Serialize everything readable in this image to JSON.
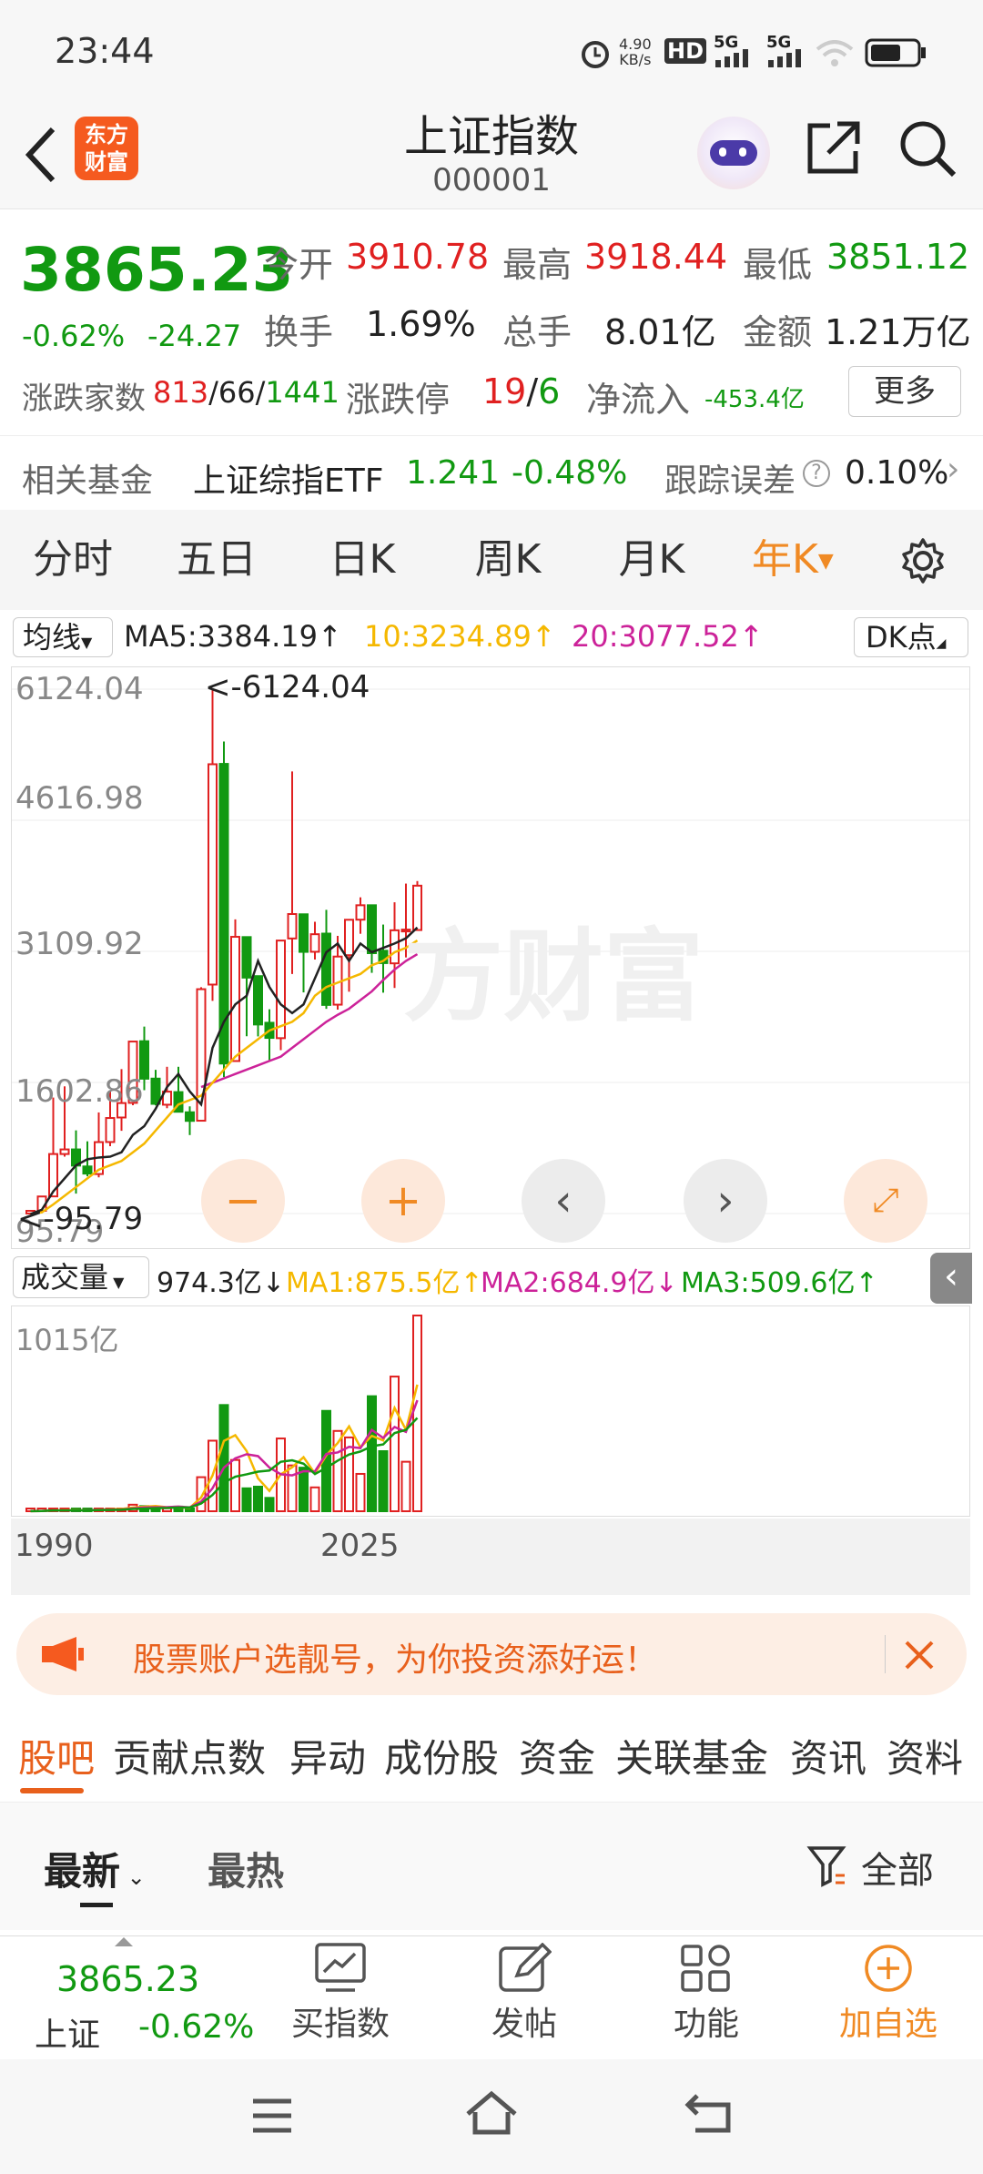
{
  "status_bar": {
    "time": "23:44",
    "net_speed_top": "4.90",
    "net_speed_bottom": "KB/s",
    "hd": "HD",
    "sig1": "5G",
    "sig2": "5G"
  },
  "header": {
    "title": "上证指数",
    "code": "000001",
    "logo_line1": "东方",
    "logo_line2": "财富"
  },
  "quote": {
    "price": "3865.23",
    "change_pct": "-0.62%",
    "change_abs": "-24.27",
    "open_label": "今开",
    "open": "3910.78",
    "high_label": "最高",
    "high": "3918.44",
    "low_label": "最低",
    "low": "3851.12",
    "turnover_label": "换手",
    "turnover": "1.69%",
    "volume_label": "总手",
    "volume": "8.01亿",
    "amount_label": "金额",
    "amount": "1.21万亿",
    "breadth_label": "涨跌家数",
    "breadth_up": "813",
    "breadth_flat": "66",
    "breadth_down": "1441",
    "limit_label": "涨跌停",
    "limit_up": "19",
    "limit_down": "6",
    "netflow_label": "净流入",
    "netflow": "-453.4亿",
    "more_button": "更多"
  },
  "fund": {
    "label": "相关基金",
    "name": "上证综指ETF",
    "price": "1.241",
    "change": "-0.48%",
    "error_label": "跟踪误差",
    "error_value": "0.10%"
  },
  "chart_tabs": [
    "分时",
    "五日",
    "日K",
    "周K",
    "月K",
    "年K"
  ],
  "ma_bar": {
    "selector": "均线",
    "ma5": "MA5:3384.19↑",
    "ma10": "10:3234.89↑",
    "ma20": "20:3077.52↑",
    "dk": "DK点"
  },
  "colors": {
    "up": "#e02020",
    "down": "#119911",
    "accent": "#f08a24",
    "ma5": "#222222",
    "ma10": "#f5b800",
    "ma20": "#cc2299"
  },
  "chart_data": [
    {
      "type": "candlestick",
      "title": "",
      "ylabels": [
        "6124.04",
        "4616.98",
        "3109.92",
        "1602.86",
        "95.79"
      ],
      "ylim": [
        95.79,
        6124.04
      ],
      "annotations": [
        "<-6124.04",
        "<-95.79"
      ],
      "x_range": [
        "1990",
        "2025"
      ],
      "candles": [
        {
          "o": 96,
          "h": 127,
          "l": 96,
          "c": 127
        },
        {
          "o": 127,
          "h": 292,
          "l": 104,
          "c": 292
        },
        {
          "o": 293,
          "h": 1429,
          "l": 292,
          "c": 780
        },
        {
          "o": 780,
          "h": 1558,
          "l": 750,
          "c": 833
        },
        {
          "o": 833,
          "h": 1052,
          "l": 325,
          "c": 647
        },
        {
          "o": 637,
          "h": 926,
          "l": 524,
          "c": 555
        },
        {
          "o": 550,
          "h": 1258,
          "l": 512,
          "c": 917
        },
        {
          "o": 918,
          "h": 1510,
          "l": 870,
          "c": 1194
        },
        {
          "o": 1200,
          "h": 1756,
          "l": 1047,
          "c": 1366
        },
        {
          "o": 1368,
          "h": 2073,
          "l": 1341,
          "c": 2073
        },
        {
          "o": 2077,
          "h": 2245,
          "l": 1514,
          "c": 1646
        },
        {
          "o": 1647,
          "h": 1748,
          "l": 1339,
          "c": 1357
        },
        {
          "o": 1347,
          "h": 1783,
          "l": 1307,
          "c": 1497
        },
        {
          "o": 1492,
          "h": 1783,
          "l": 1259,
          "c": 1266
        },
        {
          "o": 1260,
          "h": 1328,
          "l": 998,
          "c": 1161
        },
        {
          "o": 1163,
          "h": 2698,
          "l": 1161,
          "c": 2675
        },
        {
          "o": 2728,
          "h": 6124,
          "l": 2541,
          "c": 5261
        },
        {
          "o": 5265,
          "h": 5522,
          "l": 1664,
          "c": 1820
        },
        {
          "o": 1849,
          "h": 3478,
          "l": 1844,
          "c": 3277
        },
        {
          "o": 3274,
          "h": 3186,
          "l": 2134,
          "c": 2808
        },
        {
          "o": 2825,
          "h": 2478,
          "l": 2132,
          "c": 2269
        },
        {
          "o": 2289,
          "h": 2444,
          "l": 1849,
          "c": 2115
        },
        {
          "o": 2112,
          "h": 3239,
          "l": 1974,
          "c": 3234
        },
        {
          "o": 3258,
          "h": 5178,
          "l": 2850,
          "c": 3539
        },
        {
          "o": 3536,
          "h": 3538,
          "l": 2638,
          "c": 3104
        },
        {
          "o": 3105,
          "h": 3450,
          "l": 3016,
          "c": 3307
        },
        {
          "o": 3314,
          "h": 3587,
          "l": 2449,
          "c": 2494
        },
        {
          "o": 2497,
          "h": 3288,
          "l": 2440,
          "c": 3050
        },
        {
          "o": 3066,
          "h": 3474,
          "l": 2646,
          "c": 3473
        },
        {
          "o": 3474,
          "h": 3731,
          "l": 3312,
          "c": 3640
        },
        {
          "o": 3640,
          "h": 3424,
          "l": 2863,
          "c": 3089
        },
        {
          "o": 3117,
          "h": 3418,
          "l": 2635,
          "c": 2975
        },
        {
          "o": 2972,
          "h": 3674,
          "l": 2689,
          "c": 3352
        },
        {
          "o": 3347,
          "h": 3889,
          "l": 3040,
          "c": 3360
        },
        {
          "o": 3355,
          "h": 3918,
          "l": 3352,
          "c": 3865
        }
      ],
      "ma5": [
        90,
        140,
        350,
        500,
        650,
        720,
        740,
        750,
        800,
        1000,
        1100,
        1300,
        1550,
        1700,
        1500,
        1350,
        2000,
        2300,
        2500,
        2600,
        3000,
        2700,
        2500,
        2400,
        2500,
        2800,
        3100,
        3200,
        3000,
        3200,
        3100,
        3150,
        3200,
        3260,
        3384
      ],
      "ma10": [
        90,
        110,
        200,
        300,
        400,
        500,
        600,
        650,
        700,
        800,
        900,
        1050,
        1200,
        1350,
        1400,
        1450,
        1600,
        1750,
        1900,
        2000,
        2100,
        2200,
        2250,
        2300,
        2400,
        2600,
        2700,
        2750,
        2800,
        2850,
        2950,
        3000,
        3100,
        3150,
        3235
      ],
      "ma20": [
        1550,
        1600,
        1650,
        1700,
        1750,
        1800,
        1850,
        1900,
        2000,
        2100,
        2200,
        2300,
        2380,
        2450,
        2550,
        2650,
        2780,
        2900,
        3000,
        3078
      ]
    },
    {
      "type": "bar",
      "title": "",
      "series_label": "成交量",
      "ylabels": [
        "1015亿"
      ],
      "ma1": "MA1:875.5亿↑",
      "ma2": "MA2:684.9亿↓",
      "ma3": "MA3:509.6亿↑",
      "current": "974.3亿↓"
    }
  ],
  "volume_bar": {
    "selector": "成交量",
    "current": "974.3亿↓",
    "ma1": "MA1:875.5亿↑",
    "ma2": "MA2:684.9亿↓",
    "ma3": "MA3:509.6亿↑",
    "ylabel": "1015亿",
    "x_start": "1990",
    "x_end": "2025"
  },
  "ad_banner": {
    "text": "股票账户选靓号，为你投资添好运！"
  },
  "section_tabs": [
    "股吧",
    "贡献点数",
    "异动",
    "成份股",
    "资金",
    "关联基金",
    "资讯",
    "资料"
  ],
  "sort_tabs": {
    "latest": "最新",
    "hot": "最热",
    "filter": "全部"
  },
  "bottom_bar": {
    "price": "3865.23",
    "name": "上证",
    "change": "-0.62%",
    "buy": "买指数",
    "post": "发帖",
    "function": "功能",
    "add": "加自选"
  }
}
